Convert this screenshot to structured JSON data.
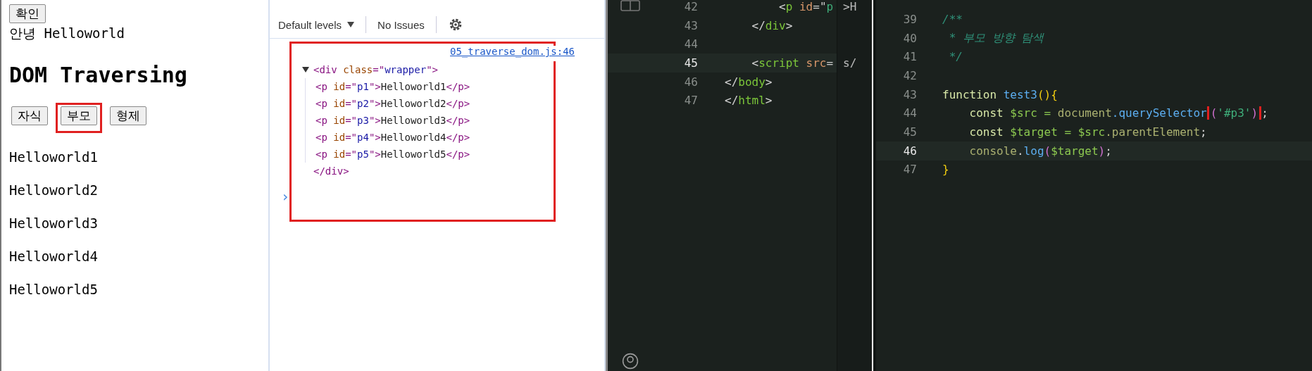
{
  "page": {
    "top_button": "확인",
    "greeting": "안녕 Helloworld",
    "heading": "DOM Traversing",
    "buttons": [
      {
        "label": "자식",
        "highlight": false
      },
      {
        "label": "부모",
        "highlight": true
      },
      {
        "label": "형제",
        "highlight": false
      }
    ],
    "paragraphs": [
      "Helloworld1",
      "Helloworld2",
      "Helloworld3",
      "Helloworld4",
      "Helloworld5"
    ]
  },
  "devtools": {
    "levels": "Default levels",
    "issues": "No Issues",
    "output_highlight": true,
    "source_link": "05_traverse_dom.js:46",
    "tree": {
      "expanded": true,
      "open": [
        {
          "text": "<div",
          "kind": "tag"
        },
        {
          "text": " class",
          "kind": "attr"
        },
        {
          "text": "=\"",
          "kind": "tag"
        },
        {
          "text": "wrapper",
          "kind": "value"
        },
        {
          "text": "\">",
          "kind": "tag"
        }
      ],
      "children": [
        [
          {
            "text": "<p",
            "kind": "tag"
          },
          {
            "text": " id",
            "kind": "attr"
          },
          {
            "text": "=\"",
            "kind": "tag"
          },
          {
            "text": "p1",
            "kind": "value"
          },
          {
            "text": "\">",
            "kind": "tag"
          },
          {
            "text": "Helloworld1",
            "kind": "text"
          },
          {
            "text": "</p>",
            "kind": "tag"
          }
        ],
        [
          {
            "text": "<p",
            "kind": "tag"
          },
          {
            "text": " id",
            "kind": "attr"
          },
          {
            "text": "=\"",
            "kind": "tag"
          },
          {
            "text": "p2",
            "kind": "value"
          },
          {
            "text": "\">",
            "kind": "tag"
          },
          {
            "text": "Helloworld2",
            "kind": "text"
          },
          {
            "text": "</p>",
            "kind": "tag"
          }
        ],
        [
          {
            "text": "<p",
            "kind": "tag"
          },
          {
            "text": " id",
            "kind": "attr"
          },
          {
            "text": "=\"",
            "kind": "tag"
          },
          {
            "text": "p3",
            "kind": "value"
          },
          {
            "text": "\">",
            "kind": "tag"
          },
          {
            "text": "Helloworld3",
            "kind": "text"
          },
          {
            "text": "</p>",
            "kind": "tag"
          }
        ],
        [
          {
            "text": "<p",
            "kind": "tag"
          },
          {
            "text": " id",
            "kind": "attr"
          },
          {
            "text": "=\"",
            "kind": "tag"
          },
          {
            "text": "p4",
            "kind": "value"
          },
          {
            "text": "\">",
            "kind": "tag"
          },
          {
            "text": "Helloworld4",
            "kind": "text"
          },
          {
            "text": "</p>",
            "kind": "tag"
          }
        ],
        [
          {
            "text": "<p",
            "kind": "tag"
          },
          {
            "text": " id",
            "kind": "attr"
          },
          {
            "text": "=\"",
            "kind": "tag"
          },
          {
            "text": "p5",
            "kind": "value"
          },
          {
            "text": "\">",
            "kind": "tag"
          },
          {
            "text": "Helloworld5",
            "kind": "text"
          },
          {
            "text": "</p>",
            "kind": "tag"
          }
        ]
      ],
      "close": [
        {
          "text": "</div>",
          "kind": "tag"
        }
      ]
    },
    "prompt": "›"
  },
  "editor_left": {
    "lines": [
      {
        "number": "42",
        "current": false,
        "tokens": [
          {
            "text": "        <",
            "kind": "punct"
          },
          {
            "text": "p",
            "kind": "tagname"
          },
          {
            "text": " id",
            "kind": "attr"
          },
          {
            "text": "=\"",
            "kind": "punct"
          },
          {
            "text": "p",
            "kind": "string"
          }
        ],
        "peek": ">H"
      },
      {
        "number": "43",
        "current": false,
        "tokens": [
          {
            "text": "    </",
            "kind": "punct"
          },
          {
            "text": "div",
            "kind": "tagname"
          },
          {
            "text": ">",
            "kind": "punct"
          }
        ]
      },
      {
        "number": "44",
        "current": false
      },
      {
        "number": "45",
        "current": true,
        "tokens": [
          {
            "text": "    <",
            "kind": "punct"
          },
          {
            "text": "script",
            "kind": "tagname"
          },
          {
            "text": " src",
            "kind": "attr"
          },
          {
            "text": "=",
            "kind": "punct"
          }
        ],
        "peek": "s/"
      },
      {
        "number": "46",
        "current": false,
        "tokens": [
          {
            "text": "</",
            "kind": "punct"
          },
          {
            "text": "body",
            "kind": "tagname"
          },
          {
            "text": ">",
            "kind": "punct"
          }
        ]
      },
      {
        "number": "47",
        "current": false,
        "tokens": [
          {
            "text": "</",
            "kind": "punct"
          },
          {
            "text": "html",
            "kind": "tagname"
          },
          {
            "text": ">",
            "kind": "punct"
          }
        ]
      }
    ]
  },
  "editor_right": {
    "lines": [
      {
        "number": "39",
        "current": false,
        "tokens": [
          {
            "text": "/**",
            "kind": "comment"
          }
        ]
      },
      {
        "number": "40",
        "current": false,
        "tokens": [
          {
            "text": " * 부모 방향 탐색",
            "kind": "comment"
          }
        ]
      },
      {
        "number": "41",
        "current": false,
        "tokens": [
          {
            "text": " */",
            "kind": "comment"
          }
        ]
      },
      {
        "number": "42",
        "current": false
      },
      {
        "number": "43",
        "current": false,
        "tokens": [
          {
            "text": "function ",
            "kind": "keyword"
          },
          {
            "text": "test3",
            "kind": "fn"
          },
          {
            "text": "(){",
            "kind": "bracket"
          }
        ]
      },
      {
        "number": "44",
        "current": false,
        "tokens": [
          {
            "text": "    const ",
            "kind": "keyword"
          },
          {
            "text": "$src = ",
            "kind": "var"
          },
          {
            "text": "document",
            "kind": "obj"
          },
          {
            "text": ".querySelector",
            "kind": "fn"
          },
          {
            "kind": "group",
            "highlight": true,
            "tokens": [
              {
                "text": "(",
                "kind": "paren"
              },
              {
                "text": "'#p3'",
                "kind": "string"
              },
              {
                "text": ")",
                "kind": "paren"
              }
            ]
          },
          {
            "text": ";",
            "kind": "plain"
          }
        ]
      },
      {
        "number": "45",
        "current": false,
        "tokens": [
          {
            "text": "    const ",
            "kind": "keyword"
          },
          {
            "text": "$target = $src",
            "kind": "var"
          },
          {
            "text": ".parentElement",
            "kind": "obj"
          },
          {
            "text": ";",
            "kind": "plain"
          }
        ]
      },
      {
        "number": "46",
        "current": true,
        "tokens": [
          {
            "text": "    console",
            "kind": "obj"
          },
          {
            "text": ".",
            "kind": "plain"
          },
          {
            "text": "log",
            "kind": "fn"
          },
          {
            "text": "(",
            "kind": "paren"
          },
          {
            "text": "$target",
            "kind": "var"
          },
          {
            "text": ")",
            "kind": "paren"
          },
          {
            "text": ";",
            "kind": "plain"
          }
        ]
      },
      {
        "number": "47",
        "current": false,
        "tokens": [
          {
            "text": "}",
            "kind": "bracket"
          }
        ]
      }
    ]
  }
}
